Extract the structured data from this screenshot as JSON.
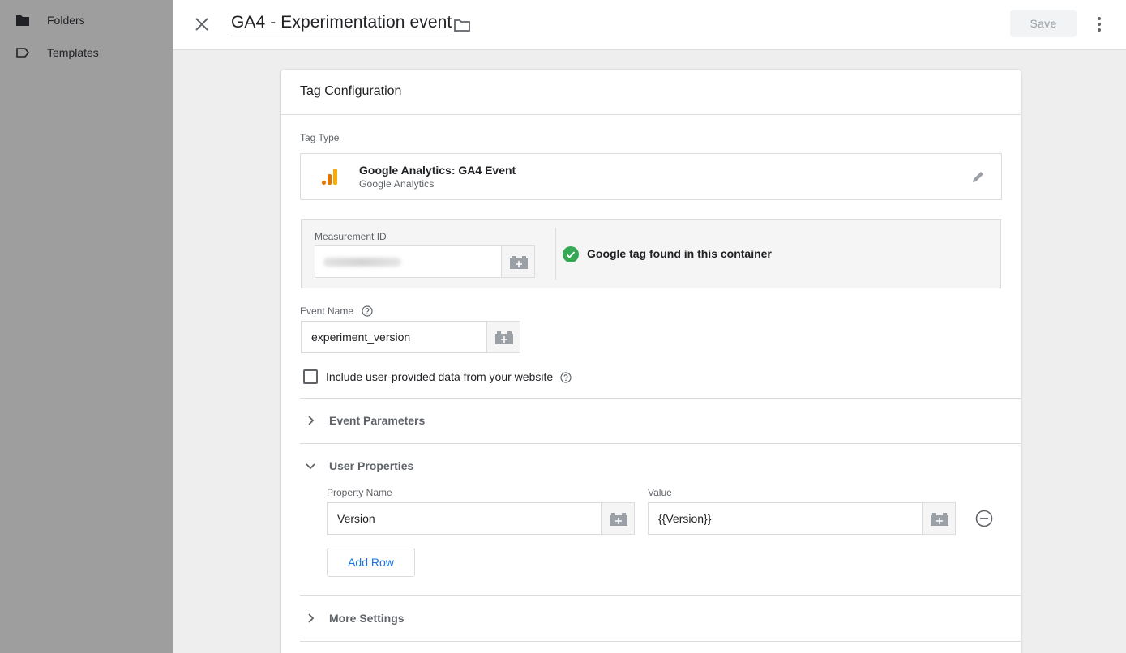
{
  "sidebar": {
    "items": [
      {
        "label": "Folders",
        "icon": "folder-icon"
      },
      {
        "label": "Templates",
        "icon": "label-icon"
      }
    ]
  },
  "header": {
    "title": "GA4 - Experimentation event",
    "save_label": "Save"
  },
  "card": {
    "title": "Tag Configuration",
    "tag_type_label": "Tag Type",
    "tag_type": {
      "name": "Google Analytics: GA4 Event",
      "vendor": "Google Analytics",
      "icon": "google-analytics-icon",
      "bar_colors": [
        "#e37400",
        "#f9ab00"
      ]
    },
    "measurement": {
      "label": "Measurement ID",
      "status_text": "Google tag found in this container",
      "status_color": "#34a853"
    },
    "event_name": {
      "label": "Event Name",
      "value": "experiment_version"
    },
    "user_data_checkbox": {
      "label": "Include user-provided data from your website",
      "checked": false
    },
    "sections": {
      "event_parameters": "Event Parameters",
      "user_properties": "User Properties",
      "more_settings": "More Settings"
    },
    "user_properties": {
      "name_header": "Property Name",
      "value_header": "Value",
      "rows": [
        {
          "name": "Version",
          "value": "{{Version}}"
        }
      ],
      "add_row_label": "Add Row"
    }
  },
  "colors": {
    "accent": "#1a73e8",
    "sidebar_dim": "#9e9e9e",
    "panel_bg": "#eeeeee"
  }
}
